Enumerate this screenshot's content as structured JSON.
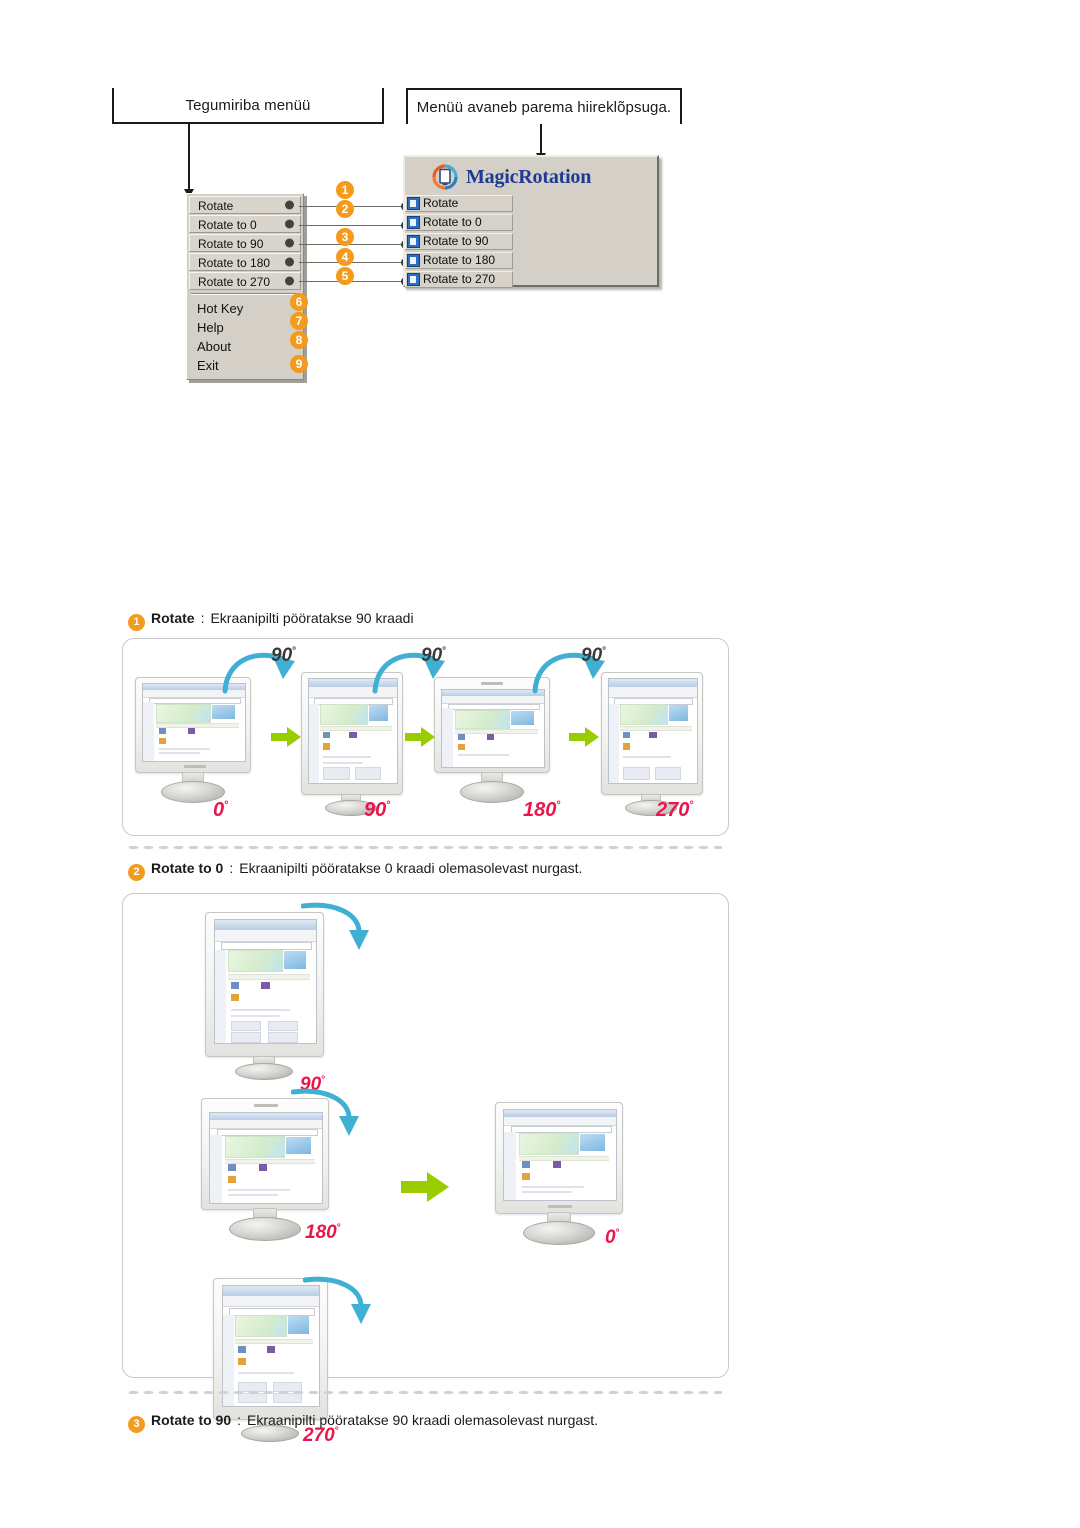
{
  "callouts": {
    "left": "Tegumiriba menüü",
    "right": "Menüü avaneb parema hiireklõpsuga."
  },
  "taskbar_menu": {
    "items": [
      {
        "label": "Rotate",
        "badge": "1"
      },
      {
        "label": "Rotate to 0",
        "badge": "2"
      },
      {
        "label": "Rotate to 90",
        "badge": "3"
      },
      {
        "label": "Rotate to 180",
        "badge": "4"
      },
      {
        "label": "Rotate to 270",
        "badge": "5"
      }
    ],
    "extras": [
      {
        "label": "Hot Key",
        "badge": "6"
      },
      {
        "label": "Help",
        "badge": "7"
      },
      {
        "label": "About",
        "badge": "8"
      },
      {
        "label": "Exit",
        "badge": "9"
      }
    ]
  },
  "magic_popup": {
    "title": "MagicRotation",
    "items": [
      {
        "label": "Rotate"
      },
      {
        "label": "Rotate to 0"
      },
      {
        "label": "Rotate to 90"
      },
      {
        "label": "Rotate to 180"
      },
      {
        "label": "Rotate to 270"
      }
    ]
  },
  "sections": [
    {
      "badge": "1",
      "term": "Rotate",
      "separator": ":",
      "text": "Ekraanipilti pööratakse 90 kraadi"
    },
    {
      "badge": "2",
      "term": "Rotate to 0",
      "separator": ":",
      "text": "Ekraanipilti pööratakse 0 kraadi olemasolevast nurgast."
    },
    {
      "badge": "3",
      "term": "Rotate to 90",
      "separator": ":",
      "text": "Ekraanipilti pööratakse 90 kraadi olemasolevast nurgast."
    }
  ],
  "panel1": {
    "step_labels": [
      "90",
      "90",
      "90"
    ],
    "state_labels": [
      "0",
      "90",
      "180",
      "270"
    ],
    "degree_symbol": "°"
  },
  "panel2": {
    "state_labels": [
      "90",
      "180",
      "270",
      "0"
    ],
    "degree_symbol": "°"
  },
  "colors": {
    "badge_orange": "#F59B1C",
    "angle_red": "#E8174B",
    "green_arrow": "#9ACD00",
    "rotate_arrow_blue": "#3FAFD4",
    "brand_blue": "#1F3A93",
    "menu_face": "#D4D0C8"
  }
}
